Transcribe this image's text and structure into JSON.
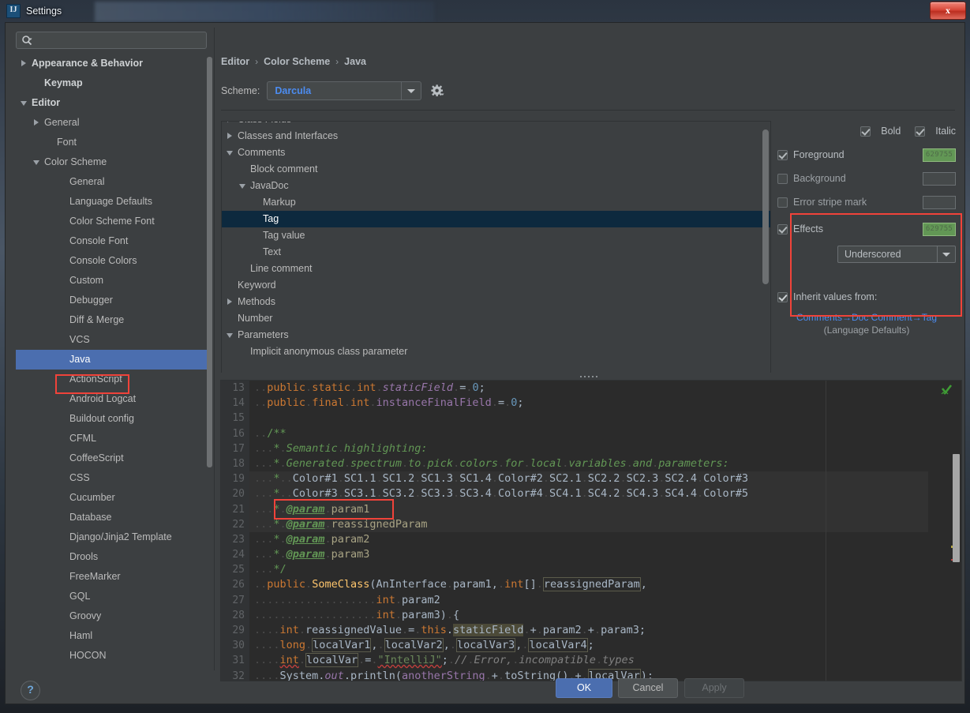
{
  "window": {
    "title": "Settings",
    "app_icon": "intellij-idea-logo",
    "close_label": "x"
  },
  "search": {
    "value": "",
    "placeholder": "",
    "icon": "search-icon"
  },
  "sidebar": {
    "items": [
      {
        "label": "Appearance & Behavior",
        "indent": 0,
        "arrow": "closed",
        "bold": true,
        "selected": false
      },
      {
        "label": "Keymap",
        "indent": 1,
        "arrow": "none",
        "bold": true,
        "selected": false
      },
      {
        "label": "Editor",
        "indent": 0,
        "arrow": "open",
        "bold": true,
        "selected": false
      },
      {
        "label": "General",
        "indent": 1,
        "arrow": "closed",
        "bold": false,
        "selected": false
      },
      {
        "label": "Font",
        "indent": 2,
        "arrow": "none",
        "bold": false,
        "selected": false
      },
      {
        "label": "Color Scheme",
        "indent": 1,
        "arrow": "open",
        "bold": false,
        "selected": false
      },
      {
        "label": "General",
        "indent": 3,
        "arrow": "none",
        "bold": false,
        "selected": false
      },
      {
        "label": "Language Defaults",
        "indent": 3,
        "arrow": "none",
        "bold": false,
        "selected": false
      },
      {
        "label": "Color Scheme Font",
        "indent": 3,
        "arrow": "none",
        "bold": false,
        "selected": false
      },
      {
        "label": "Console Font",
        "indent": 3,
        "arrow": "none",
        "bold": false,
        "selected": false
      },
      {
        "label": "Console Colors",
        "indent": 3,
        "arrow": "none",
        "bold": false,
        "selected": false
      },
      {
        "label": "Custom",
        "indent": 3,
        "arrow": "none",
        "bold": false,
        "selected": false
      },
      {
        "label": "Debugger",
        "indent": 3,
        "arrow": "none",
        "bold": false,
        "selected": false
      },
      {
        "label": "Diff & Merge",
        "indent": 3,
        "arrow": "none",
        "bold": false,
        "selected": false
      },
      {
        "label": "VCS",
        "indent": 3,
        "arrow": "none",
        "bold": false,
        "selected": false
      },
      {
        "label": "Java",
        "indent": 3,
        "arrow": "none",
        "bold": false,
        "selected": true
      },
      {
        "label": "ActionScript",
        "indent": 3,
        "arrow": "none",
        "bold": false,
        "selected": false
      },
      {
        "label": "Android Logcat",
        "indent": 3,
        "arrow": "none",
        "bold": false,
        "selected": false
      },
      {
        "label": "Buildout config",
        "indent": 3,
        "arrow": "none",
        "bold": false,
        "selected": false
      },
      {
        "label": "CFML",
        "indent": 3,
        "arrow": "none",
        "bold": false,
        "selected": false
      },
      {
        "label": "CoffeeScript",
        "indent": 3,
        "arrow": "none",
        "bold": false,
        "selected": false
      },
      {
        "label": "CSS",
        "indent": 3,
        "arrow": "none",
        "bold": false,
        "selected": false
      },
      {
        "label": "Cucumber",
        "indent": 3,
        "arrow": "none",
        "bold": false,
        "selected": false
      },
      {
        "label": "Database",
        "indent": 3,
        "arrow": "none",
        "bold": false,
        "selected": false
      },
      {
        "label": "Django/Jinja2 Template",
        "indent": 3,
        "arrow": "none",
        "bold": false,
        "selected": false
      },
      {
        "label": "Drools",
        "indent": 3,
        "arrow": "none",
        "bold": false,
        "selected": false
      },
      {
        "label": "FreeMarker",
        "indent": 3,
        "arrow": "none",
        "bold": false,
        "selected": false
      },
      {
        "label": "GQL",
        "indent": 3,
        "arrow": "none",
        "bold": false,
        "selected": false
      },
      {
        "label": "Groovy",
        "indent": 3,
        "arrow": "none",
        "bold": false,
        "selected": false
      },
      {
        "label": "Haml",
        "indent": 3,
        "arrow": "none",
        "bold": false,
        "selected": false
      },
      {
        "label": "HOCON",
        "indent": 3,
        "arrow": "none",
        "bold": false,
        "selected": false
      }
    ]
  },
  "breadcrumb": {
    "items": [
      "Editor",
      "Color Scheme",
      "Java"
    ],
    "separator": "›"
  },
  "scheme": {
    "label": "Scheme:",
    "value": "Darcula",
    "dropdown_icon": "chevron-down-icon",
    "gear_icon": "gear-icon"
  },
  "attributes": {
    "nodes": [
      {
        "label": "Class Fields",
        "indent": 0,
        "arrow": "closed",
        "selected": false
      },
      {
        "label": "Classes and Interfaces",
        "indent": 0,
        "arrow": "closed",
        "selected": false
      },
      {
        "label": "Comments",
        "indent": 0,
        "arrow": "open",
        "selected": false
      },
      {
        "label": "Block comment",
        "indent": 1,
        "arrow": "none",
        "selected": false
      },
      {
        "label": "JavaDoc",
        "indent": 1,
        "arrow": "open",
        "selected": false
      },
      {
        "label": "Markup",
        "indent": 2,
        "arrow": "none",
        "selected": false
      },
      {
        "label": "Tag",
        "indent": 2,
        "arrow": "none",
        "selected": true
      },
      {
        "label": "Tag value",
        "indent": 2,
        "arrow": "none",
        "selected": false
      },
      {
        "label": "Text",
        "indent": 2,
        "arrow": "none",
        "selected": false
      },
      {
        "label": "Line comment",
        "indent": 1,
        "arrow": "none",
        "selected": false
      },
      {
        "label": "Keyword",
        "indent": 0,
        "arrow": "none",
        "selected": false
      },
      {
        "label": "Methods",
        "indent": 0,
        "arrow": "closed",
        "selected": false
      },
      {
        "label": "Number",
        "indent": 0,
        "arrow": "none",
        "selected": false
      },
      {
        "label": "Parameters",
        "indent": 0,
        "arrow": "open",
        "selected": false
      },
      {
        "label": "Implicit anonymous class parameter",
        "indent": 1,
        "arrow": "none",
        "selected": false
      }
    ]
  },
  "options": {
    "bold": {
      "label": "Bold",
      "checked": true
    },
    "italic": {
      "label": "Italic",
      "checked": true
    },
    "foreground": {
      "label": "Foreground",
      "checked": true,
      "color": "629755",
      "color_hex": "#629755"
    },
    "background": {
      "label": "Background",
      "checked": false,
      "color": ""
    },
    "error_stripe": {
      "label": "Error stripe mark",
      "checked": false,
      "color": ""
    },
    "effects": {
      "label": "Effects",
      "checked": true,
      "color": "629755",
      "color_hex": "#629755"
    },
    "effects_type": {
      "value": "Underscored",
      "dropdown_icon": "chevron-down-icon"
    },
    "inherit": {
      "label": "Inherit values from:",
      "checked": true
    },
    "inherit_link": "Comments→Doc Comment→Tag",
    "inherit_source": "(Language Defaults)"
  },
  "preview": {
    "line_numbers": [
      "13",
      "14",
      "15",
      "16",
      "17",
      "18",
      "19",
      "20",
      "21",
      "22",
      "23",
      "24",
      "25",
      "26",
      "27",
      "28",
      "29",
      "30",
      "31",
      "32"
    ],
    "lines": [
      "  public static int staticField = 0;",
      "  public final int instanceFinalField = 0;",
      "",
      "  /**",
      "   * Semantic highlighting:",
      "   * Generated spectrum to pick colors for local variables and parameters:",
      "   *  Color#1 SC1.1 SC1.2 SC1.3 SC1.4 Color#2 SC2.1 SC2.2 SC2.3 SC2.4 Color#3",
      "   *  Color#3 SC3.1 SC3.2 SC3.3 SC3.4 Color#4 SC4.1 SC4.2 SC4.3 SC4.4 Color#5",
      "   * @param param1",
      "   * @param reassignedParam",
      "   * @param param2",
      "   * @param param3",
      "   */",
      "  public SomeClass(AnInterface param1, int[] reassignedParam,",
      "                   int param2",
      "                   int param3) {",
      "    int reassignedValue = this.staticField + param2 + param3;",
      "    long localVar1, localVar2, localVar3, localVar4;",
      "    int localVar = \"IntelliJ\"; // Error, incompatible types",
      "    System.out.println(anotherString + toString() + localVar);"
    ],
    "status_icon": "inspection-ok-checkmark-icon"
  },
  "footer": {
    "help_label": "?",
    "ok_label": "OK",
    "cancel_label": "Cancel",
    "apply_label": "Apply"
  },
  "colors": {
    "accent_blue": "#4b6eaf",
    "link_blue": "#4c8cf0",
    "highlight_red": "#f0433a",
    "swatch_green": "#629755",
    "panel_bg": "#3c3f41",
    "editor_bg": "#2b2b2b"
  }
}
